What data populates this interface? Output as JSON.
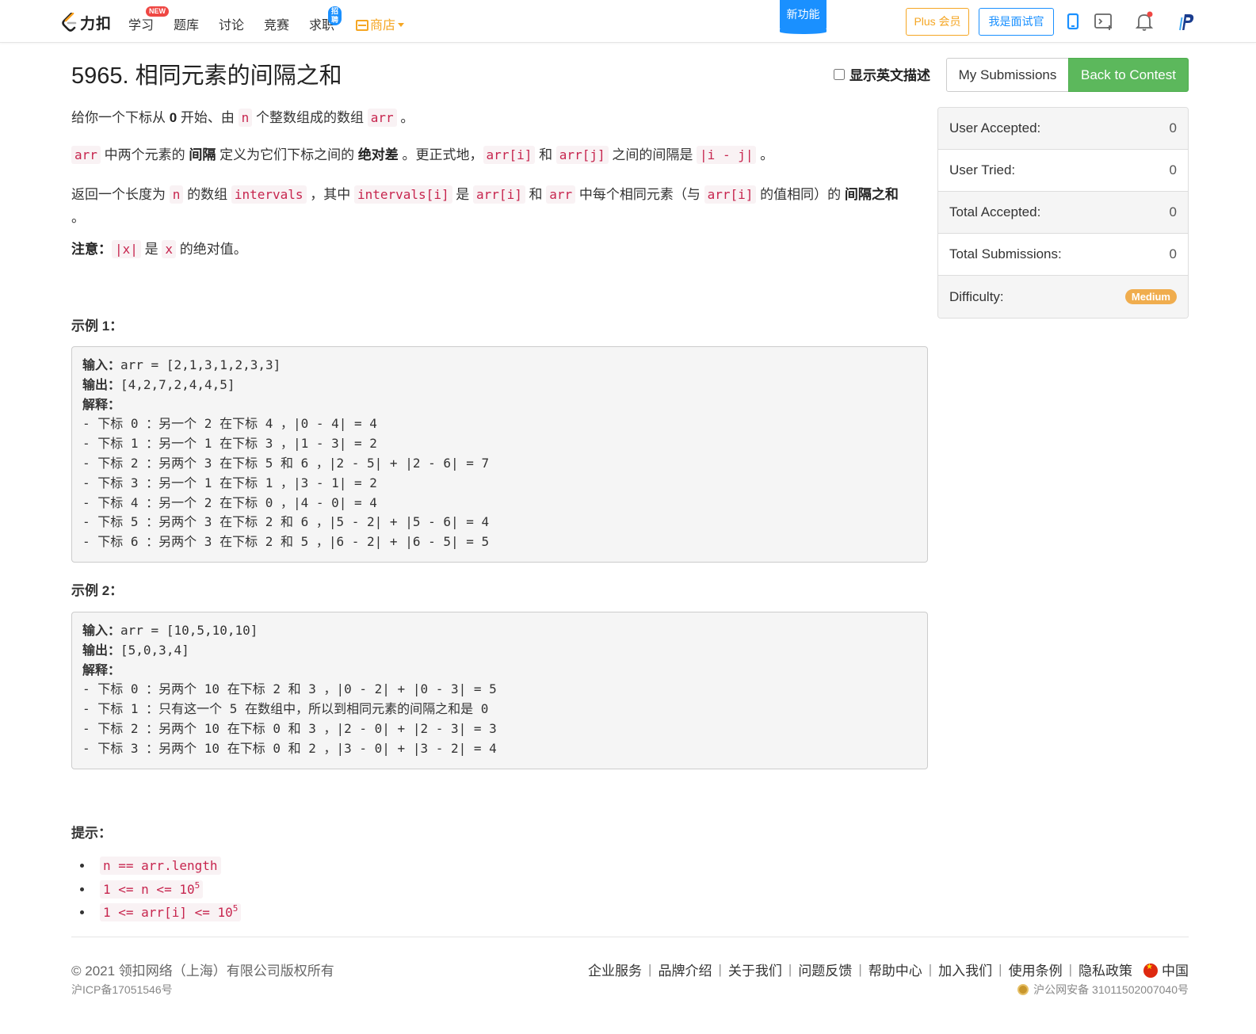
{
  "nav": {
    "logo_text": "力扣",
    "items": [
      "学习",
      "题库",
      "讨论",
      "竞赛",
      "求职"
    ],
    "badge_new": "NEW",
    "badge_hire": "招聘",
    "store": "商店",
    "new_feature": "新功能",
    "plus_label": "Plus 会员",
    "interviewer_label": "我是面试官"
  },
  "problem": {
    "title": "5965. 相同元素的间隔之和",
    "show_english_label": "显示英文描述",
    "my_submissions": "My Submissions",
    "back_to_contest": "Back to Contest"
  },
  "stats": [
    {
      "label": "User Accepted:",
      "value": "0"
    },
    {
      "label": "User Tried:",
      "value": "0"
    },
    {
      "label": "Total Accepted:",
      "value": "0"
    },
    {
      "label": "Total Submissions:",
      "value": "0"
    }
  ],
  "difficulty": {
    "label": "Difficulty:",
    "value": "Medium",
    "color": "#f0ad4e"
  },
  "desc": {
    "p1": [
      "给你一个下标从 ",
      "0",
      " 开始、由 ",
      "n",
      " 个整数组成的数组 ",
      "arr",
      " 。"
    ],
    "p2": [
      "arr",
      " 中两个元素的 ",
      "间隔",
      " 定义为它们下标之间的 ",
      "绝对差",
      " 。更正式地，",
      "arr[i]",
      " 和 ",
      "arr[j]",
      " 之间的间隔是 ",
      "|i - j|",
      " 。"
    ],
    "p3": [
      "返回一个长度为 ",
      "n",
      " 的数组 ",
      "intervals",
      " ，其中 ",
      "intervals[i]",
      " 是 ",
      "arr[i]",
      " 和 ",
      "arr",
      " 中每个相同元素（与 ",
      "arr[i]",
      " 的值相同）的 ",
      "间隔之和"
    ],
    "p3_end": "。",
    "note": [
      "注意：",
      "|x|",
      " 是 ",
      "x",
      " 的绝对值。"
    ]
  },
  "example1": {
    "title": "示例 1：",
    "input_label": "输入：",
    "input": "arr = [2,1,3,1,2,3,3]",
    "output_label": "输出：",
    "output": "[4,2,7,2,4,4,5]",
    "explain_label": "解释：",
    "lines": [
      "- 下标 0 ：另一个 2 在下标 4 ，|0 - 4| = 4",
      "- 下标 1 ：另一个 1 在下标 3 ，|1 - 3| = 2",
      "- 下标 2 ：另两个 3 在下标 5 和 6 ，|2 - 5| + |2 - 6| = 7",
      "- 下标 3 ：另一个 1 在下标 1 ，|3 - 1| = 2",
      "- 下标 4 ：另一个 2 在下标 0 ，|4 - 0| = 4",
      "- 下标 5 ：另两个 3 在下标 2 和 6 ，|5 - 2| + |5 - 6| = 4",
      "- 下标 6 ：另两个 3 在下标 2 和 5 ，|6 - 2| + |6 - 5| = 5"
    ]
  },
  "example2": {
    "title": "示例 2：",
    "input_label": "输入：",
    "input": "arr = [10,5,10,10]",
    "output_label": "输出：",
    "output": "[5,0,3,4]",
    "explain_label": "解释：",
    "lines": [
      "- 下标 0 ：另两个 10 在下标 2 和 3 ，|0 - 2| + |0 - 3| = 5",
      "- 下标 1 ：只有这一个 5 在数组中，所以到相同元素的间隔之和是 0",
      "- 下标 2 ：另两个 10 在下标 0 和 3 ，|2 - 0| + |2 - 3| = 3",
      "- 下标 3 ：另两个 10 在下标 0 和 2 ，|3 - 0| + |3 - 2| = 4"
    ]
  },
  "hints": {
    "title": "提示：",
    "items": [
      {
        "text": "n == arr.length",
        "sup": ""
      },
      {
        "text": "1 <= n <= 10",
        "sup": "5"
      },
      {
        "text": "1 <= arr[i] <= 10",
        "sup": "5"
      }
    ]
  },
  "footer": {
    "copyright": "© 2021 领扣网络（上海）有限公司版权所有",
    "icp": "沪ICP备17051546号",
    "links": [
      "企业服务",
      "品牌介绍",
      "关于我们",
      "问题反馈",
      "帮助中心",
      "加入我们",
      "使用条例",
      "隐私政策"
    ],
    "region": "中国",
    "police": "沪公网安备 31011502007040号"
  }
}
